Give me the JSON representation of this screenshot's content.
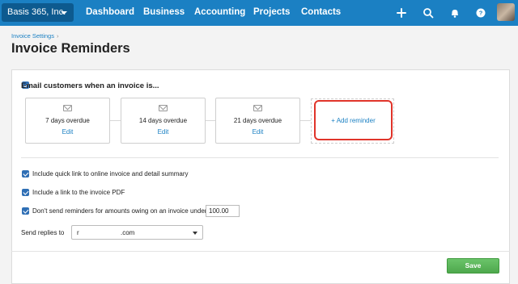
{
  "topbar": {
    "org_name": "Basis 365, Inc.",
    "nav": [
      "Dashboard",
      "Business",
      "Accounting",
      "Projects",
      "Contacts"
    ],
    "icons": [
      "plus-icon",
      "search-icon",
      "bell-icon",
      "help-icon",
      "avatar"
    ]
  },
  "header": {
    "breadcrumb": "Invoice Settings",
    "breadcrumb_sep": "›",
    "title": "Invoice Reminders"
  },
  "email_section": {
    "label": "Email customers when an invoice is...",
    "checked": true,
    "reminders": [
      {
        "text": "7 days overdue",
        "edit": "Edit"
      },
      {
        "text": "14 days overdue",
        "edit": "Edit"
      },
      {
        "text": "21 days overdue",
        "edit": "Edit"
      }
    ],
    "add_label": "+ Add reminder"
  },
  "options": [
    {
      "label": "Include quick link to online invoice and detail summary",
      "checked": true
    },
    {
      "label": "Include a link to the invoice PDF",
      "checked": true
    },
    {
      "label": "Don't send reminders for amounts owing on an invoice under",
      "checked": true
    }
  ],
  "min_amount": "100.00",
  "replies": {
    "label": "Send replies to",
    "value_start": "r",
    "value_end": ".com"
  },
  "save_label": "Save",
  "colors": {
    "nav_bg": "#1b80c3",
    "link": "#1b80c3",
    "highlight": "#e0342a",
    "save": "#5cb85c"
  }
}
